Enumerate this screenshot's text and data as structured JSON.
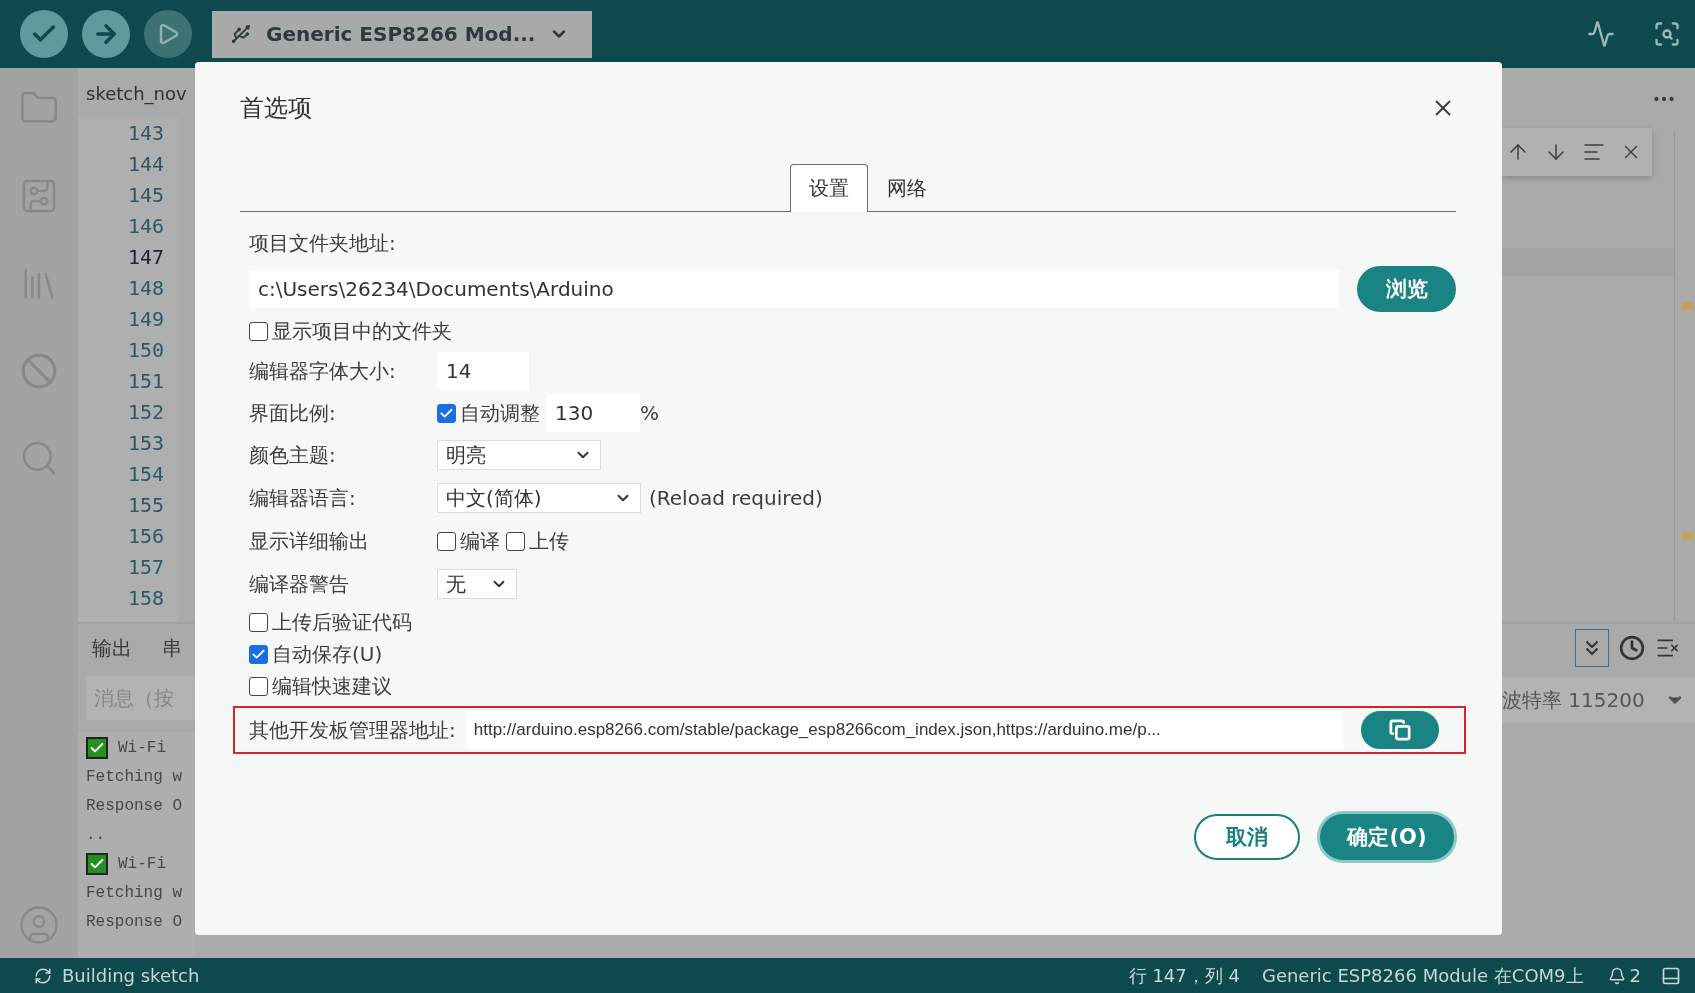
{
  "toolbar": {
    "buttons": [
      {
        "kind": "verify",
        "disabled": false
      },
      {
        "kind": "upload",
        "disabled": false
      },
      {
        "kind": "debug",
        "disabled": true
      }
    ],
    "board": "Generic ESP8266 Mod..."
  },
  "editor": {
    "tab": "sketch_nov",
    "lines": [
      {
        "number": "143",
        "selected": false
      },
      {
        "number": "144",
        "selected": false
      },
      {
        "number": "145",
        "selected": false
      },
      {
        "number": "146",
        "selected": false
      },
      {
        "number": "147",
        "selected": true
      },
      {
        "number": "148",
        "selected": false
      },
      {
        "number": "149",
        "selected": false
      },
      {
        "number": "150",
        "selected": false
      },
      {
        "number": "151",
        "selected": false
      },
      {
        "number": "152",
        "selected": false
      },
      {
        "number": "153",
        "selected": false
      },
      {
        "number": "154",
        "selected": false
      },
      {
        "number": "155",
        "selected": false
      },
      {
        "number": "156",
        "selected": false
      },
      {
        "number": "157",
        "selected": false
      },
      {
        "number": "158",
        "selected": false
      }
    ]
  },
  "bottom_panel": {
    "tabs": [
      "输出",
      "串"
    ],
    "message_placeholder": "消息（按",
    "output": [
      {
        "kind": "check",
        "text": "Wi-Fi"
      },
      {
        "kind": "text",
        "text": "Fetching w"
      },
      {
        "kind": "text",
        "text": "Response O"
      },
      {
        "kind": "text",
        "text": ".."
      },
      {
        "kind": "check",
        "text": "Wi-Fi"
      },
      {
        "kind": "text",
        "text": "Fetching w"
      },
      {
        "kind": "text",
        "text": "Response O"
      }
    ],
    "baud": "波特率 115200"
  },
  "dialog": {
    "title": "首选项",
    "tabs": [
      {
        "label": "设置",
        "selected": true
      },
      {
        "label": "网络",
        "selected": false
      }
    ],
    "sketchbook": {
      "label": "项目文件夹地址:",
      "value": "c:\\Users\\26234\\Documents\\Arduino",
      "button": "浏览"
    },
    "show_files": {
      "label": "显示项目中的文件夹",
      "checked": false
    },
    "font_size": {
      "label": "编辑器字体大小:",
      "value": "14"
    },
    "scale": {
      "label": "界面比例:",
      "auto": {
        "label": "自动调整",
        "checked": true
      },
      "value": "130",
      "unit": "%"
    },
    "theme": {
      "label": "颜色主题:",
      "value": "明亮"
    },
    "language": {
      "label": "编辑器语言:",
      "value": "中文(简体)",
      "note": "(Reload required)"
    },
    "verbose": {
      "label": "显示详细输出",
      "options": [
        {
          "label": "编译",
          "checked": false
        },
        {
          "label": "上传",
          "checked": false
        }
      ]
    },
    "warnings": {
      "label": "编译器警告",
      "value": "无"
    },
    "options": [
      {
        "label": "上传后验证代码",
        "checked": false
      },
      {
        "label": "自动保存(U)",
        "checked": true
      },
      {
        "label": "编辑快速建议",
        "checked": false
      }
    ],
    "board_urls": {
      "label": "其他开发板管理器地址:",
      "value": "http://arduino.esp8266.com/stable/package_esp8266com_index.json,https://arduino.me/p...",
      "highlighted": true
    },
    "buttons": [
      {
        "label": "取消",
        "kind": "secondary"
      },
      {
        "label": "确定(O)",
        "kind": "primary"
      }
    ]
  },
  "status_bar": {
    "activity": "Building sketch",
    "position": "行 147，列 4",
    "board": "Generic ESP8266 Module 在COM9上",
    "notifications": "2"
  }
}
